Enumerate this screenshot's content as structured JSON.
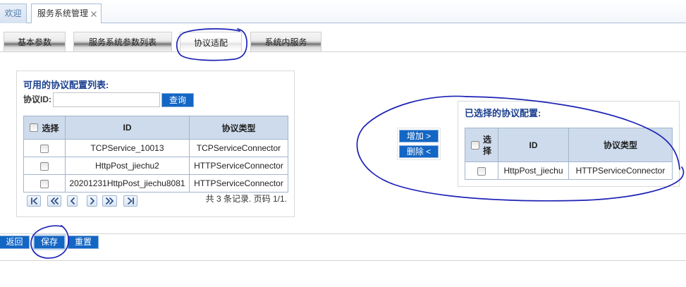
{
  "tabs": [
    {
      "label": "欢迎"
    },
    {
      "label": "服务系统管理",
      "icon": "close-icon"
    }
  ],
  "subtabs": [
    {
      "label": "基本参数"
    },
    {
      "label": "服务系统参数列表"
    },
    {
      "label": "协议适配",
      "active": true
    },
    {
      "label": "系统内服务"
    }
  ],
  "available": {
    "title": "可用的协议配置列表:",
    "search": {
      "label": "协议ID:",
      "value": "",
      "button": "查询"
    },
    "columns": {
      "select": "选择",
      "id": "ID",
      "type": "协议类型"
    },
    "rows": [
      {
        "checked": false,
        "id": "TCPService_10013",
        "type": "TCPServiceConnector"
      },
      {
        "checked": false,
        "id": "HttpPost_jiechu2",
        "type": "HTTPServiceConnector"
      },
      {
        "checked": false,
        "id": "20201231HttpPost_jiechu8081",
        "type": "HTTPServiceConnector"
      }
    ],
    "pager": {
      "buttons": [
        "first-page-icon",
        "fast-backward-icon",
        "prev-page-icon",
        "next-page-icon",
        "fast-forward-icon",
        "last-page-icon"
      ],
      "summary": "共 3 条记录. 页码 1/1."
    }
  },
  "transfer": {
    "add": "增加 >",
    "remove": "删除 <"
  },
  "selected": {
    "title": "已选择的协议配置:",
    "columns": {
      "select": "选择",
      "id": "ID",
      "type": "协议类型"
    },
    "rows": [
      {
        "checked": false,
        "id": "HttpPost_jiechu",
        "type": "HTTPServiceConnector"
      }
    ]
  },
  "actions": {
    "back": "返回",
    "save": "保存",
    "reset": "重置"
  },
  "colors": {
    "button_blue": "#1366c4",
    "title_blue": "#1b3f8f",
    "table_header": "#cddbec",
    "annotation_ink": "#1d22b4"
  }
}
